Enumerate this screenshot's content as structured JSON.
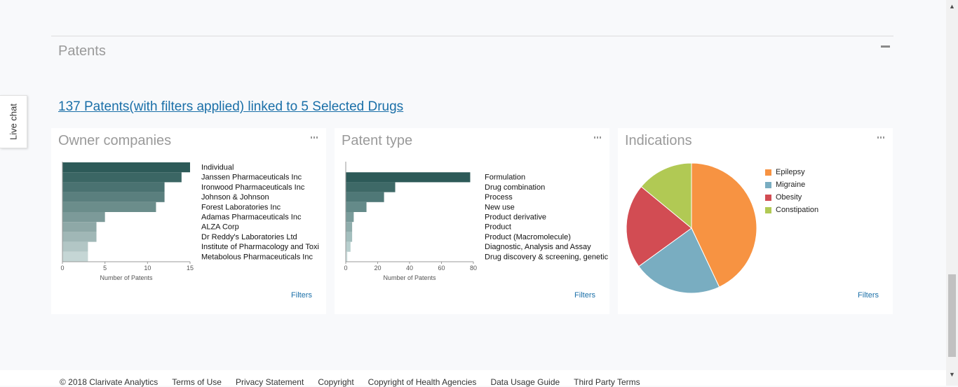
{
  "section": {
    "title": "Patents"
  },
  "live_chat": {
    "label": "Live chat"
  },
  "summary": {
    "count": "137",
    "middle": " Patents(with filters applied) linked to ",
    "drugs": "5",
    "end": " Selected Drugs"
  },
  "cards": {
    "owner": {
      "title": "Owner companies",
      "filters": "Filters"
    },
    "type": {
      "title": "Patent type",
      "filters": "Filters"
    },
    "indications": {
      "title": "Indications",
      "filters": "Filters"
    }
  },
  "chart_data": [
    {
      "type": "bar",
      "orientation": "horizontal",
      "categories": [
        "Individual",
        "Janssen Pharmaceuticals Inc",
        "Ironwood Pharmaceuticals Inc",
        "Johnson & Johnson",
        "Forest Laboratories Inc",
        "Adamas Pharmaceuticals Inc",
        "ALZA Corp",
        "Dr Reddy's Laboratories Ltd",
        "Institute of Pharmacology and Toxi",
        "Metabolous Pharmaceuticals Inc"
      ],
      "values": [
        15,
        14,
        12,
        12,
        11,
        5,
        4,
        4,
        3,
        3
      ],
      "xlabel": "Number of Patents",
      "xticks": [
        "0",
        "5",
        "10",
        "15"
      ],
      "xlim": [
        0,
        15
      ],
      "colors": [
        "#2d5a58",
        "#3b6664",
        "#4a7271",
        "#5a7f7e",
        "#6b8d8b",
        "#7c9a99",
        "#8ea8a7",
        "#a0b7b6",
        "#b2c6c5",
        "#c5d6d5"
      ]
    },
    {
      "type": "bar",
      "orientation": "horizontal",
      "categories": [
        "",
        "Formulation",
        "Drug combination",
        "Process",
        "New use",
        "Product derivative",
        "Product",
        "Product (Macromolecule)",
        "Diagnostic, Analysis and Assay",
        "Drug discovery & screening, genetic"
      ],
      "values": [
        0,
        78,
        31,
        24,
        13,
        5,
        4,
        4,
        3,
        1
      ],
      "xlabel": "Number of Patents",
      "xticks": [
        "0",
        "20",
        "40",
        "60",
        "80"
      ],
      "xlim": [
        0,
        80
      ],
      "colors": [
        "#2d5a58",
        "#2d5a58",
        "#3e6967",
        "#4f7877",
        "#648a89",
        "#799b9a",
        "#8eacab",
        "#a3bebd",
        "#b8cfce",
        "#cde0df"
      ]
    },
    {
      "type": "pie",
      "labels": [
        "Epilepsy",
        "Migraine",
        "Obesity",
        "Constipation"
      ],
      "values": [
        43,
        22,
        21,
        14
      ],
      "colors": [
        "#f79342",
        "#79adc1",
        "#d24c53",
        "#b1c954"
      ]
    }
  ],
  "footer": {
    "links": [
      "© 2018 Clarivate Analytics",
      "Terms of Use",
      "Privacy Statement",
      "Copyright",
      "Copyright of Health Agencies",
      "Data Usage Guide",
      "Third Party Terms"
    ]
  }
}
